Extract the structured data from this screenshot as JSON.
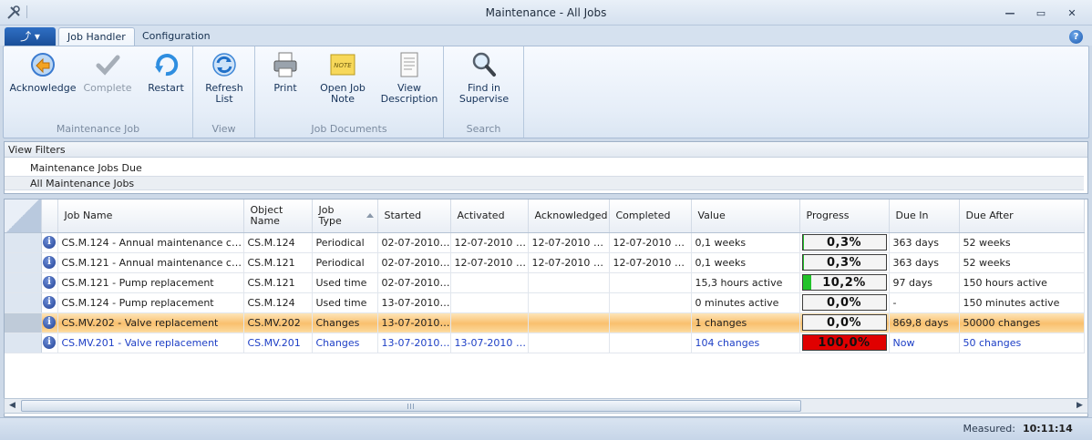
{
  "window": {
    "title": "Maintenance - All Jobs",
    "minimize": "—",
    "maximize": "▭",
    "close": "✕"
  },
  "ribbon": {
    "app_menu_label": "⤴ ▾",
    "tabs": [
      {
        "label": "Job Handler",
        "active": true
      },
      {
        "label": "Configuration",
        "active": false
      }
    ],
    "help": "?",
    "groups": [
      {
        "label": "Maintenance Job",
        "buttons": [
          {
            "label": "Acknowledge",
            "icon": "acknowledge-icon",
            "enabled": true
          },
          {
            "label": "Complete",
            "icon": "checkmark-icon",
            "enabled": false
          },
          {
            "label": "Restart",
            "icon": "restart-icon",
            "enabled": true
          }
        ]
      },
      {
        "label": "View",
        "buttons": [
          {
            "label": "Refresh List",
            "line1": "Refresh",
            "line2": "List",
            "icon": "refresh-icon",
            "enabled": true
          }
        ]
      },
      {
        "label": "Job Documents",
        "buttons": [
          {
            "label": "Print",
            "icon": "printer-icon",
            "enabled": true
          },
          {
            "label": "Open Job Note",
            "line1": "Open Job",
            "line2": "Note",
            "icon": "note-icon",
            "icon_text": "NOTE",
            "enabled": true
          },
          {
            "label": "View Description",
            "line1": "View",
            "line2": "Description",
            "icon": "document-icon",
            "enabled": true
          }
        ]
      },
      {
        "label": "Search",
        "buttons": [
          {
            "label": "Find in Supervise",
            "line1": "Find in",
            "line2": "Supervise",
            "icon": "magnifier-icon",
            "enabled": true
          }
        ]
      }
    ]
  },
  "filters": {
    "header": "View Filters",
    "items": [
      {
        "label": "Maintenance Jobs Due",
        "selected": false
      },
      {
        "label": "All Maintenance Jobs",
        "selected": true
      }
    ]
  },
  "grid": {
    "columns": [
      {
        "key": "name",
        "label": "Job Name"
      },
      {
        "key": "object",
        "label": "Object Name",
        "line1": "Object",
        "line2": "Name"
      },
      {
        "key": "type",
        "label": "Job Type",
        "line1": "Job",
        "line2": "Type",
        "sorted": "ascending"
      },
      {
        "key": "started",
        "label": "Started"
      },
      {
        "key": "activated",
        "label": "Activated"
      },
      {
        "key": "acknowledged",
        "label": "Acknowledged"
      },
      {
        "key": "completed",
        "label": "Completed"
      },
      {
        "key": "value",
        "label": "Value"
      },
      {
        "key": "progress",
        "label": "Progress"
      },
      {
        "key": "due_in",
        "label": "Due In"
      },
      {
        "key": "due_after",
        "label": "Due After"
      }
    ],
    "info_glyph": "i",
    "rows": [
      {
        "name": "CS.M.124 - Annual maintenance check",
        "object": "CS.M.124",
        "type": "Periodical",
        "started": "02-07-2010 0...",
        "activated": "12-07-2010 0...",
        "acknowledged": "12-07-2010 08:...",
        "completed": "12-07-2010 08:...",
        "value": "0,1 weeks",
        "progress": "0,3%",
        "progress_value": 0.003,
        "due_in": "363 days",
        "due_after": "52 weeks",
        "style": "normal"
      },
      {
        "name": "CS.M.121 - Annual maintenance check",
        "object": "CS.M.121",
        "type": "Periodical",
        "started": "02-07-2010 0...",
        "activated": "12-07-2010 0...",
        "acknowledged": "12-07-2010 08:...",
        "completed": "12-07-2010 08:...",
        "value": "0,1 weeks",
        "progress": "0,3%",
        "progress_value": 0.003,
        "due_in": "363 days",
        "due_after": "52 weeks",
        "style": "normal"
      },
      {
        "name": "CS.M.121 - Pump replacement",
        "object": "CS.M.121",
        "type": "Used time",
        "started": "02-07-2010 0...",
        "activated": "",
        "acknowledged": "",
        "completed": "",
        "value": "15,3 hours active",
        "progress": "10,2%",
        "progress_value": 0.102,
        "due_in": "97 days",
        "due_after": "150 hours active",
        "style": "normal"
      },
      {
        "name": "CS.M.124 - Pump replacement",
        "object": "CS.M.124",
        "type": "Used time",
        "started": "13-07-2010 0...",
        "activated": "",
        "acknowledged": "",
        "completed": "",
        "value": "0 minutes active",
        "progress": "0,0%",
        "progress_value": 0.0,
        "due_in": "-",
        "due_after": "150 minutes active",
        "style": "normal"
      },
      {
        "name": "CS.MV.202 - Valve replacement",
        "object": "CS.MV.202",
        "type": "Changes",
        "started": "13-07-2010 0...",
        "activated": "",
        "acknowledged": "",
        "completed": "",
        "value": "1 changes",
        "progress": "0,0%",
        "progress_value": 0.0,
        "due_in": "869,8 days",
        "due_after": "50000 changes",
        "style": "highlight"
      },
      {
        "name": "CS.MV.201 - Valve replacement",
        "object": "CS.MV.201",
        "type": "Changes",
        "started": "13-07-2010 0...",
        "activated": "13-07-2010 0...",
        "acknowledged": "",
        "completed": "",
        "value": "104 changes",
        "progress": "100,0%",
        "progress_value": 1.0,
        "due_in": "Now",
        "due_after": "50 changes",
        "style": "overdue"
      }
    ],
    "colors": {
      "progress_green": "#22c32a",
      "progress_red": "#e00000",
      "overdue_text": "#1d3fc6"
    }
  },
  "scrollbar": {
    "left_arrow": "◀",
    "right_arrow": "▶"
  },
  "status": {
    "label": "Measured:",
    "time": "10:11:14"
  }
}
